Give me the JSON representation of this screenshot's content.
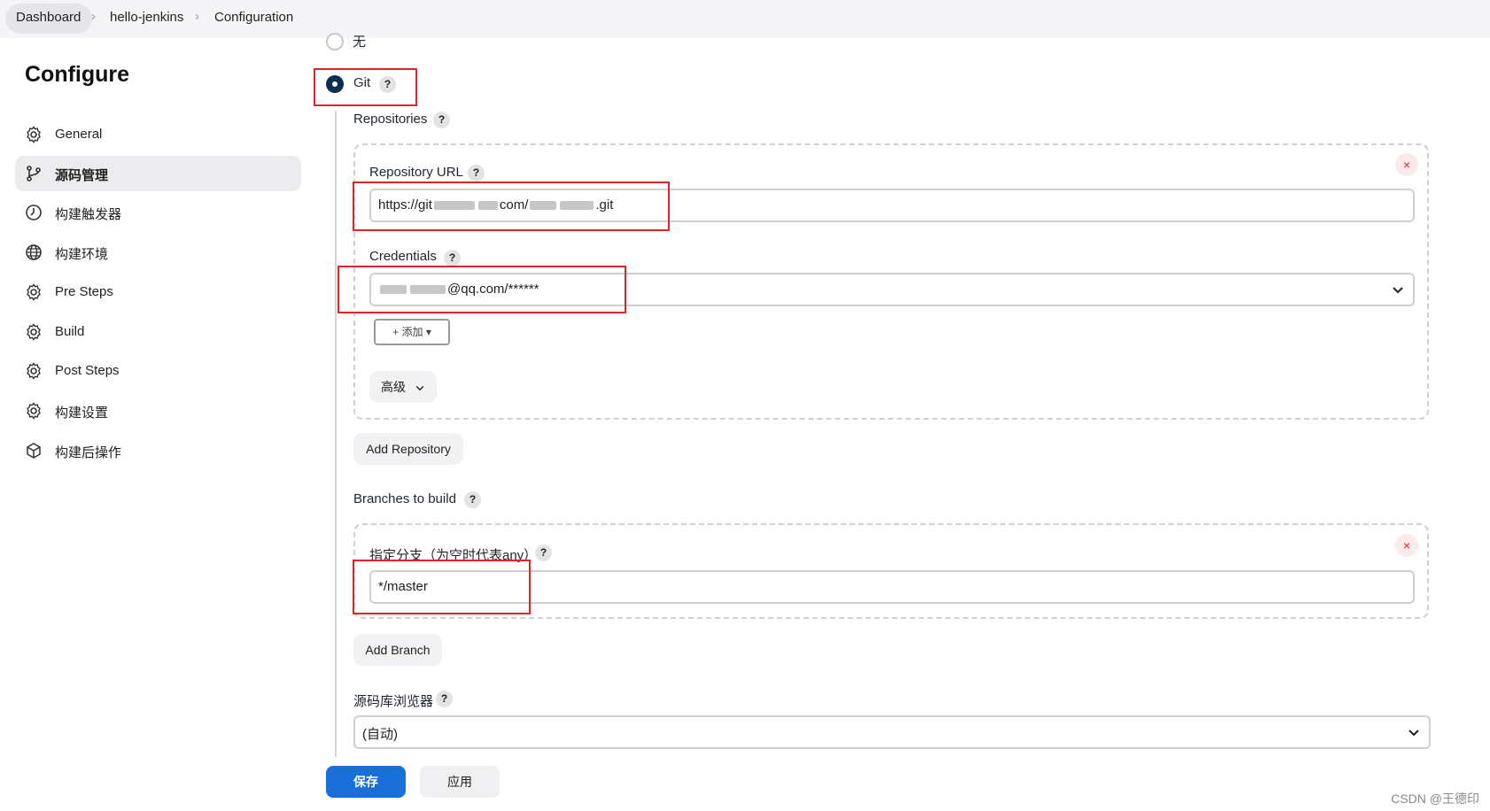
{
  "breadcrumb": {
    "items": [
      "Dashboard",
      "hello-jenkins",
      "Configuration"
    ]
  },
  "sidebar": {
    "title": "Configure",
    "items": [
      {
        "label": "General",
        "icon": "gear-icon"
      },
      {
        "label": "源码管理",
        "icon": "branch-icon"
      },
      {
        "label": "构建触发器",
        "icon": "clock-icon"
      },
      {
        "label": "构建环境",
        "icon": "globe-icon"
      },
      {
        "label": "Pre Steps",
        "icon": "gear-icon"
      },
      {
        "label": "Build",
        "icon": "gear-icon"
      },
      {
        "label": "Post Steps",
        "icon": "gear-icon"
      },
      {
        "label": "构建设置",
        "icon": "gear-icon"
      },
      {
        "label": "构建后操作",
        "icon": "cube-icon"
      }
    ],
    "active_index": 1
  },
  "scm": {
    "none_label": "无",
    "git_label": "Git",
    "repositories_label": "Repositories",
    "repo_url_label": "Repository URL",
    "repo_url_prefix": "https://git",
    "repo_url_mid": "com/",
    "repo_url_suffix": ".git",
    "credentials_label": "Credentials",
    "credentials_value_suffix": "@qq.com/******",
    "add_credentials_label": "+ 添加 ▾",
    "advanced_label": "高级",
    "add_repository_label": "Add Repository",
    "branches_label": "Branches to build",
    "branch_specifier_label": "指定分支（为空时代表any）",
    "branch_value": "*/master",
    "add_branch_label": "Add Branch",
    "browser_label": "源码库浏览器",
    "browser_value": "(自动)",
    "help_glyph": "?",
    "remove_glyph": "×"
  },
  "footer": {
    "save_label": "保存",
    "apply_label": "应用"
  },
  "watermark": "CSDN @王德印",
  "colors": {
    "accent": "#1a6fd8",
    "highlight_border": "#e0242a",
    "radio_selected": "#0d2e4e"
  }
}
